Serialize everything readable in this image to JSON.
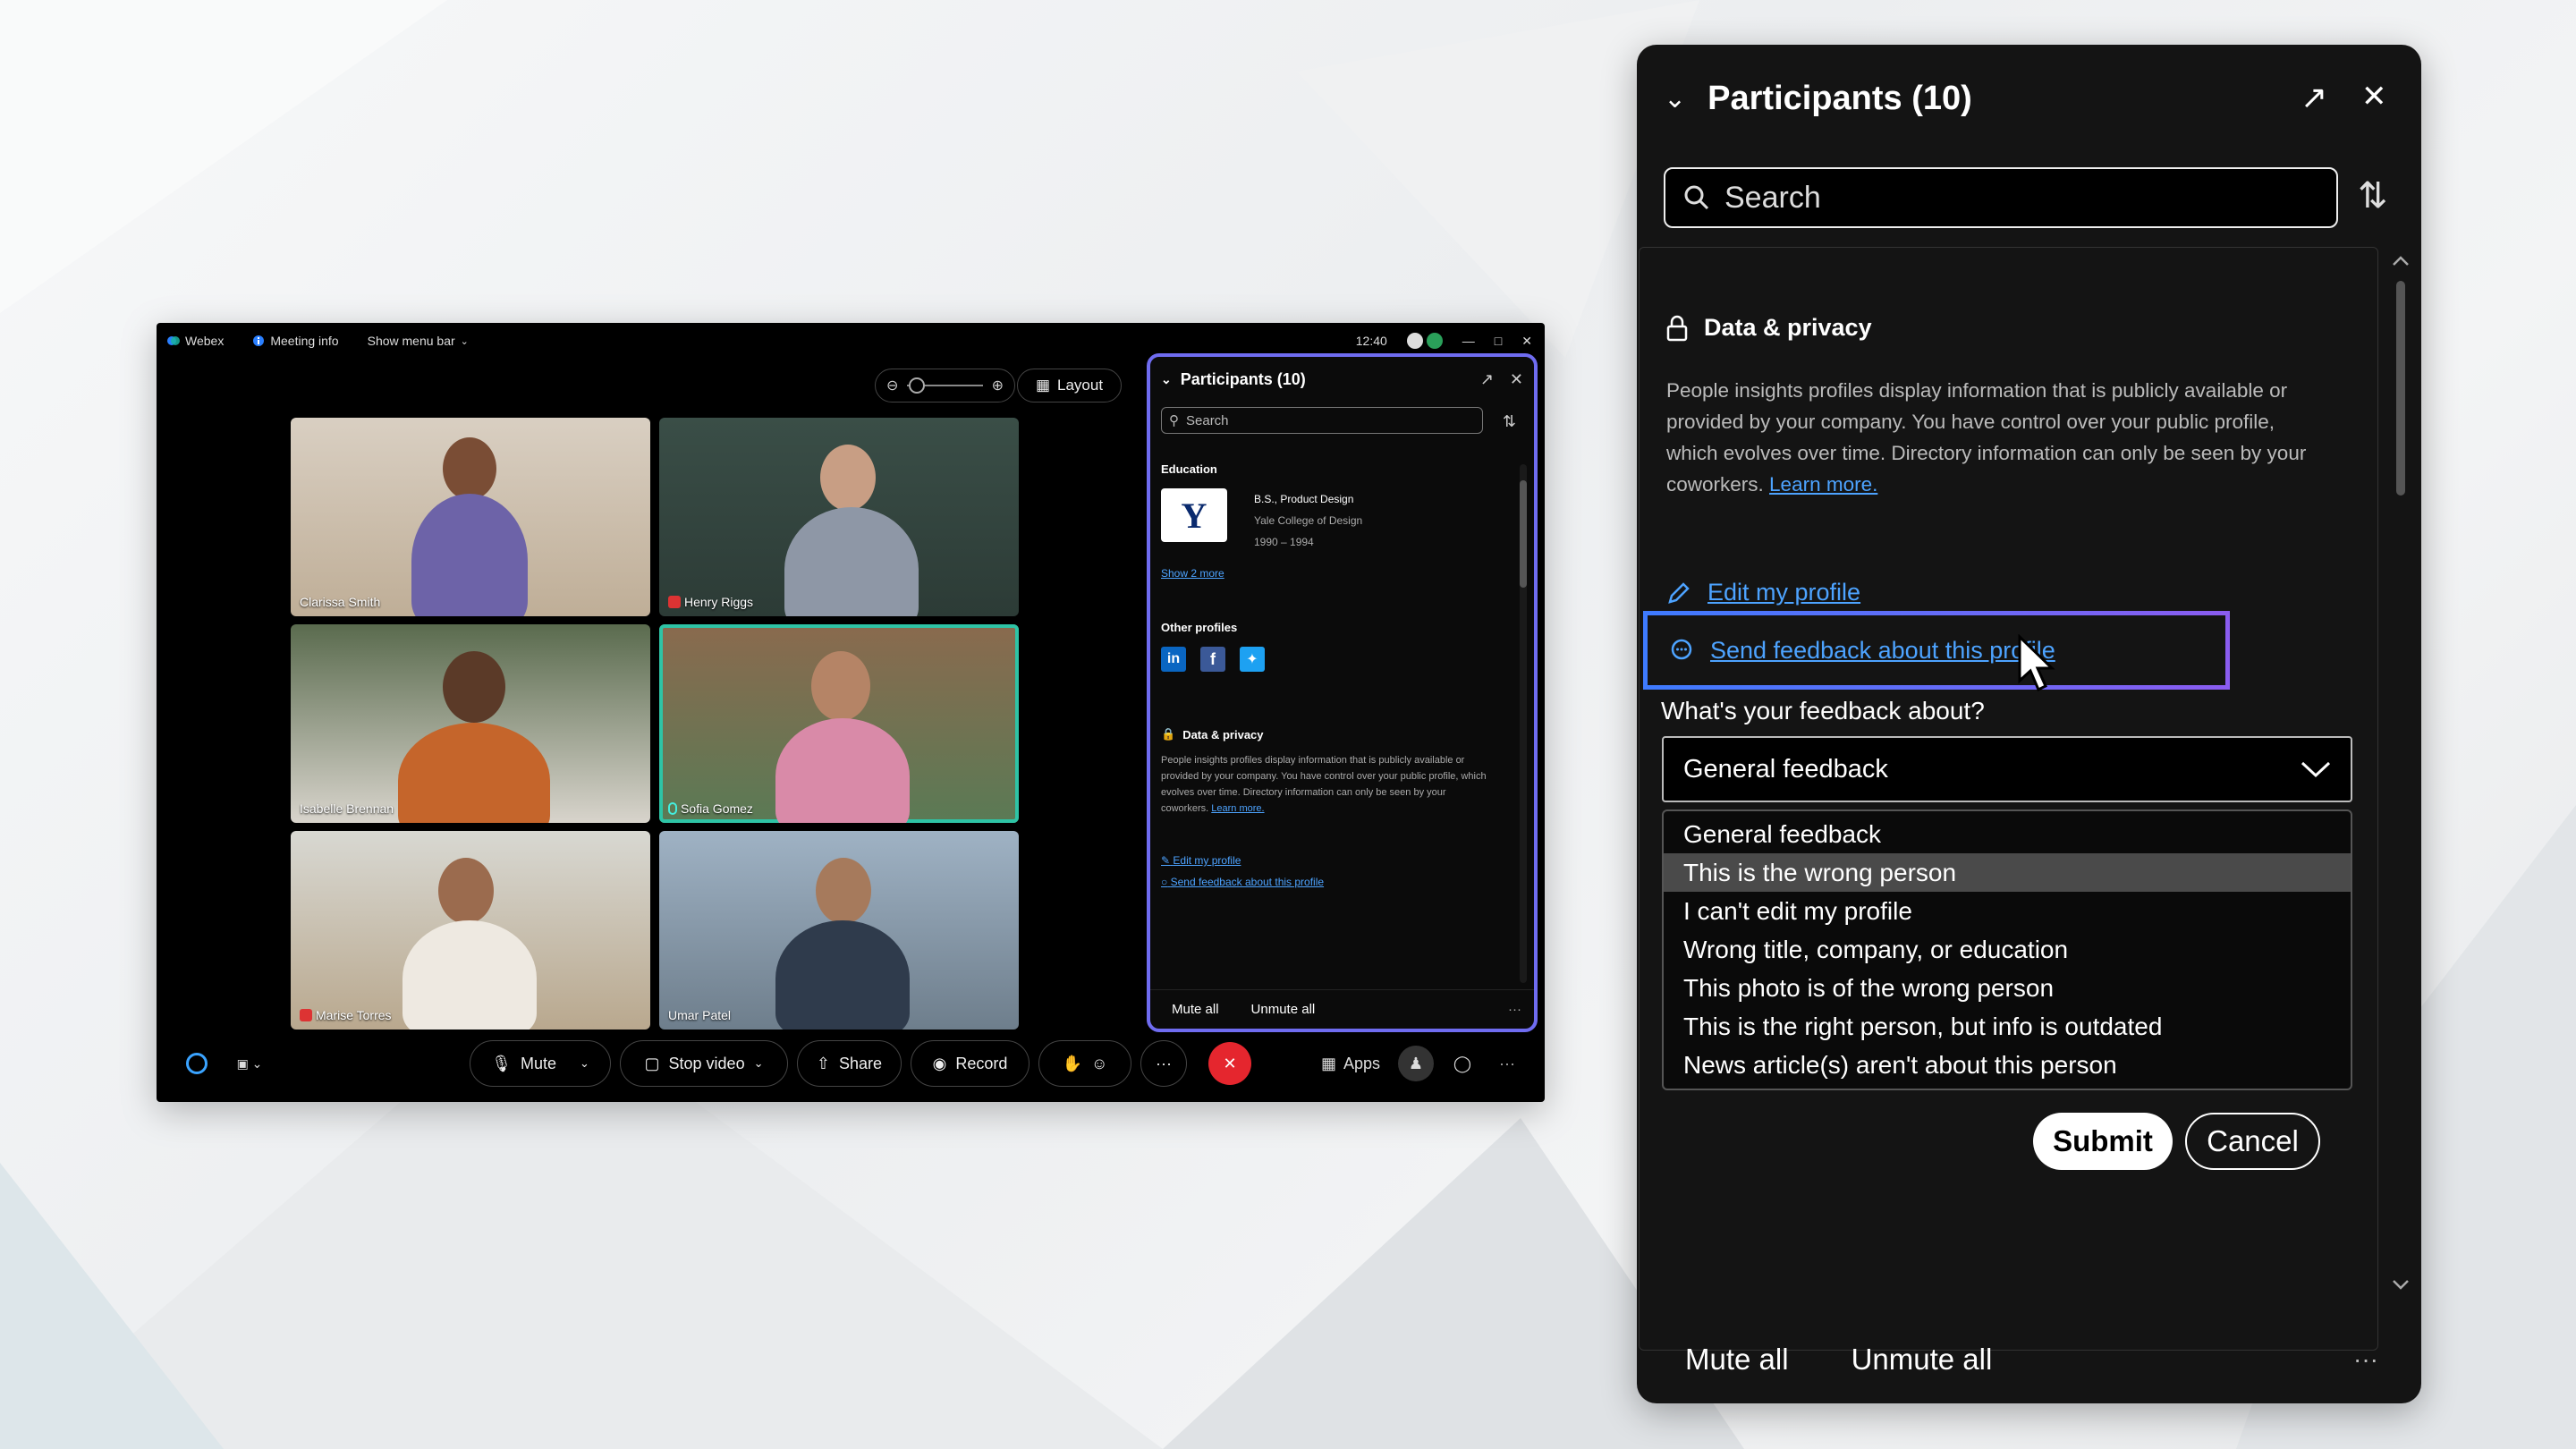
{
  "meeting_window": {
    "titlebar": {
      "app_name": "Webex",
      "meeting_info": "Meeting info",
      "show_menu_bar": "Show menu bar",
      "time": "12:40"
    },
    "layout_label": "Layout",
    "participants": [
      {
        "name": "Clarissa Smith",
        "muted": false,
        "active": false
      },
      {
        "name": "Henry Riggs",
        "muted": true,
        "active": false
      },
      {
        "name": "Isabelle Brennan",
        "muted": false,
        "active": false
      },
      {
        "name": "Sofia Gomez",
        "muted": false,
        "active": true
      },
      {
        "name": "Marise Torres",
        "muted": true,
        "active": false
      },
      {
        "name": "Umar Patel",
        "muted": false,
        "active": false
      }
    ],
    "side_panel": {
      "title": "Participants (10)",
      "search_placeholder": "Search",
      "education_heading": "Education",
      "degree": "B.S., Product Design",
      "school": "Yale College of Design",
      "years": "1990 – 1994",
      "school_logo": "Y",
      "show_more": "Show 2 more",
      "other_profiles_heading": "Other profiles",
      "data_privacy_heading": "Data & privacy",
      "privacy_text": "People insights profiles display information that is publicly available or provided by your company. You have control over your public profile, which evolves over time. Directory information can only be seen by your coworkers.",
      "learn_more": "Learn more.",
      "edit_profile": "Edit my profile",
      "send_feedback": "Send feedback about this profile",
      "mute_all": "Mute all",
      "unmute_all": "Unmute all",
      "more": "···"
    },
    "toolbar": {
      "mute": "Mute",
      "stop_video": "Stop video",
      "share": "Share",
      "record": "Record",
      "more": "···",
      "apps": "Apps"
    }
  },
  "panel": {
    "title": "Participants (10)",
    "search_placeholder": "Search",
    "data_privacy_heading": "Data & privacy",
    "privacy_text": "People insights profiles display information that is publicly available or provided by your company. You have control over your public profile, which evolves over time. Directory information can only be seen by your coworkers.",
    "learn_more": "Learn more.",
    "edit_profile": "Edit my profile",
    "send_feedback": "Send feedback about this profile",
    "feedback_question": "What's your feedback about?",
    "selected_option": "General feedback",
    "options": [
      "General feedback",
      "This is the wrong person",
      "I can't edit my profile",
      "Wrong title, company, or education",
      "This photo is of the wrong person",
      "This is the right person, but info is outdated",
      "News article(s) aren't about this person"
    ],
    "highlighted_option_index": 1,
    "submit": "Submit",
    "cancel": "Cancel",
    "mute_all": "Mute all",
    "unmute_all": "Unmute all",
    "more": "···"
  },
  "colors": {
    "link": "#4da3ff",
    "highlight_border": "#3e7bff",
    "active_speaker": "#2ec4a6",
    "end_call": "#e5262e"
  }
}
